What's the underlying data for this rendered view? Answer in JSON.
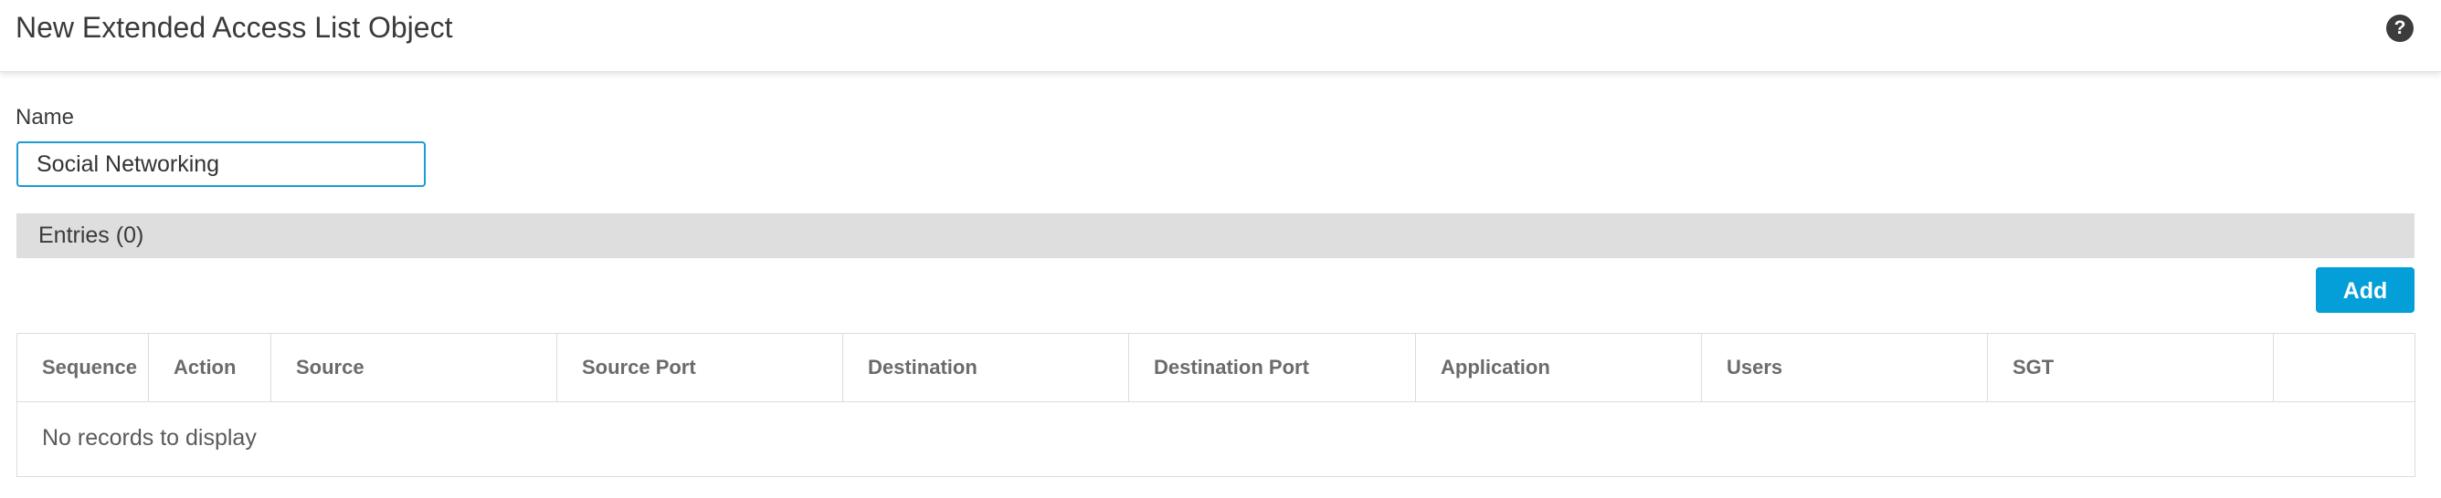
{
  "dialog": {
    "title": "New Extended Access List Object",
    "help_icon": "question-circle-icon",
    "help_glyph": "?"
  },
  "name_field": {
    "label": "Name",
    "value": "Social Networking"
  },
  "entries": {
    "label": "Entries (0)",
    "add_label": "Add"
  },
  "table": {
    "columns": [
      "Sequence",
      "Action",
      "Source",
      "Source Port",
      "Destination",
      "Destination Port",
      "Application",
      "Users",
      "SGT",
      ""
    ],
    "empty_message": "No records to display"
  },
  "colors": {
    "accent": "#049fd9",
    "input_border": "#1c9bd4",
    "section_bar": "#dedede"
  }
}
